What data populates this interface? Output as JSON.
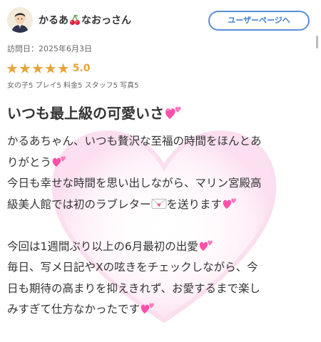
{
  "header": {
    "user_name_before": "かるあ",
    "user_name_after": "なおっさん",
    "user_page_button": "ユーザーページへ"
  },
  "visit_date": "訪問日：2025年6月3日",
  "rating": {
    "stars": 5,
    "value": "5.0",
    "scores": "女の子5 プレイ5 料金5 スタッフ5 写真5"
  },
  "review": {
    "title": "いつも最上級の可愛いさ",
    "lines": [
      "かるあちゃん、いつも贅沢な至福の時間をほんとあ",
      "りがとう",
      "今日も幸せな時間を思い出しながら、マリン宮殿高",
      "級美人館では初のラブレター",
      "を送ります",
      "今回は1週間ぶり以上の6月最初の出愛",
      "毎日、写メ日記やXの呟きをチェックしながら、今",
      "日も期待の高まりを抑えきれず、お愛するまで楽し",
      "みすぎて仕方なかったです"
    ]
  },
  "icons": {
    "avatar": "user-avatar-icon",
    "cherry": "cherry-icon",
    "heart": "two-hearts-icon",
    "envelope": "love-letter-icon",
    "star": "star-icon"
  },
  "colors": {
    "star": "#e6a53a",
    "button_border": "#5a8fd8",
    "heart": "#ff5fb0"
  }
}
